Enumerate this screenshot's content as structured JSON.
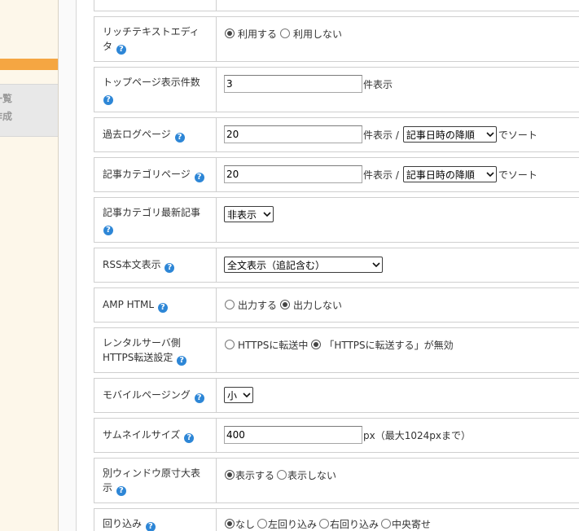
{
  "colors": {
    "sidebar_bg": "#fdf7ea",
    "sidebar_accent": "#f5a642",
    "help_icon": "#2d86d6",
    "border": "#cfcfcf"
  },
  "icons": {
    "help": "help-icon",
    "select_arrow": "chevron-down-icon"
  },
  "sidebar": {
    "items": [
      {
        "label": "一覧"
      },
      {
        "label": "作成"
      }
    ]
  },
  "settings": {
    "rich_text_editor": {
      "label": "リッチテキストエディタ",
      "options": [
        {
          "label": "利用する",
          "checked": true
        },
        {
          "label": "利用しない",
          "checked": false
        }
      ]
    },
    "top_page_count": {
      "label": "トップページ表示件数",
      "value": "3",
      "unit": "件表示"
    },
    "archive_page": {
      "label": "過去ログページ",
      "value": "20",
      "unit": "件表示 /",
      "sort": "記事日時の降順",
      "sort_suffix": "でソート"
    },
    "category_page": {
      "label": "記事カテゴリページ",
      "value": "20",
      "unit": "件表示 /",
      "sort": "記事日時の降順",
      "sort_suffix": "でソート"
    },
    "category_latest": {
      "label": "記事カテゴリ最新記事",
      "selected": "非表示"
    },
    "rss_body": {
      "label": "RSS本文表示",
      "selected": "全文表示（追記含む）"
    },
    "amp_html": {
      "label": "AMP HTML",
      "options": [
        {
          "label": "出力する",
          "checked": false
        },
        {
          "label": "出力しない",
          "checked": true
        }
      ]
    },
    "https_redirect": {
      "label": "レンタルサーバ側HTTPS転送設定",
      "options": [
        {
          "label": "HTTPSに転送中",
          "checked": false
        },
        {
          "label": "「HTTPSに転送する」が無効",
          "checked": true
        }
      ]
    },
    "mobile_paging": {
      "label": "モバイルページング",
      "selected": "小"
    },
    "thumbnail_size": {
      "label": "サムネイルサイズ",
      "value": "400",
      "unit": "px（最大1024pxまで）"
    },
    "popup_full_size": {
      "label": "別ウィンドウ原寸大表示",
      "options": [
        {
          "label": "表示する",
          "checked": true
        },
        {
          "label": "表示しない",
          "checked": false
        }
      ]
    },
    "text_wrap": {
      "label": "回り込み",
      "options": [
        {
          "label": "なし",
          "checked": true
        },
        {
          "label": "左回り込み",
          "checked": false
        },
        {
          "label": "右回り込み",
          "checked": false
        },
        {
          "label": "中央寄せ",
          "checked": false
        }
      ]
    }
  }
}
